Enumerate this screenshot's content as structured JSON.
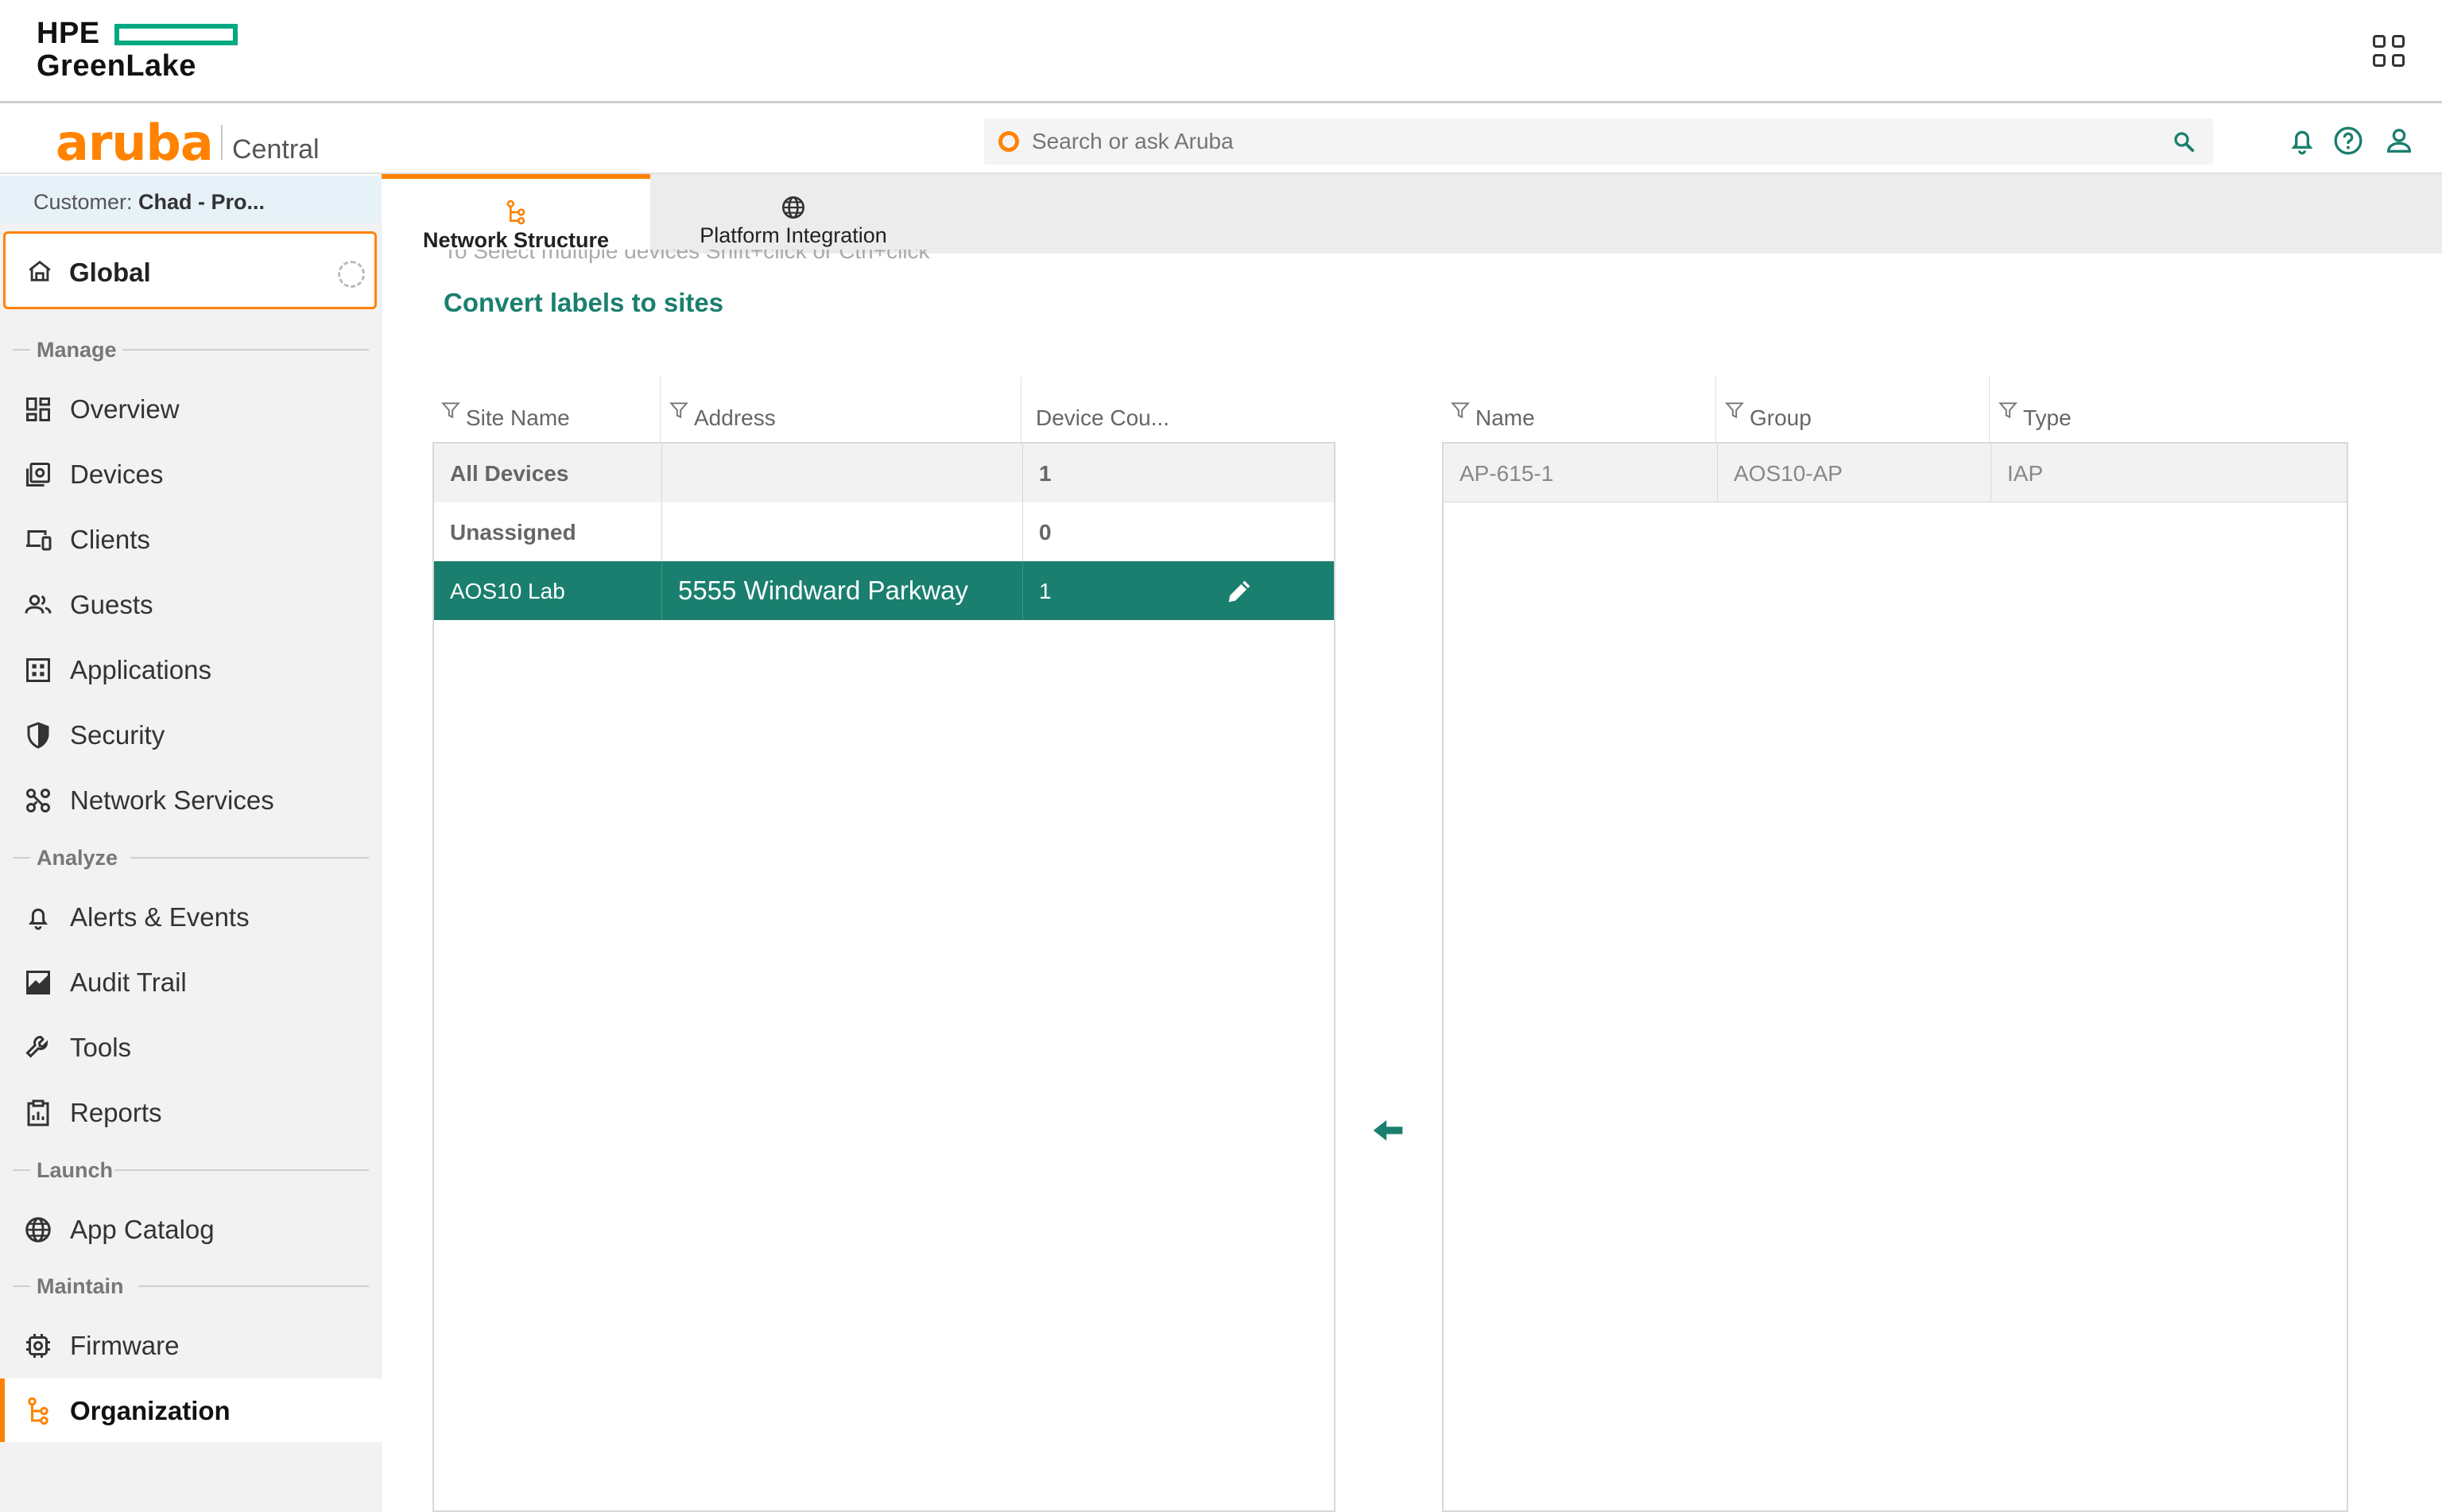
{
  "hpe": {
    "logo_line1": "HPE",
    "logo_line2": "GreenLake",
    "apps_icon": "apps-grid-icon",
    "brand_color": "#01a982"
  },
  "header": {
    "logo": "aruba",
    "product": "Central",
    "search_placeholder": "Search or ask Aruba",
    "accent": "#ff8300",
    "icons": [
      "bell-icon",
      "help-icon",
      "user-icon"
    ]
  },
  "sidebar": {
    "customer_prefix": "Customer: ",
    "customer_name": "Chad - Pro...",
    "scope": "Global",
    "sections": {
      "manage": "Manage",
      "analyze": "Analyze",
      "launch": "Launch",
      "maintain": "Maintain"
    },
    "items": {
      "overview": "Overview",
      "devices": "Devices",
      "clients": "Clients",
      "guests": "Guests",
      "applications": "Applications",
      "security": "Security",
      "network_services": "Network Services",
      "alerts_events": "Alerts & Events",
      "audit_trail": "Audit Trail",
      "tools": "Tools",
      "reports": "Reports",
      "app_catalog": "App Catalog",
      "firmware": "Firmware",
      "organization": "Organization"
    },
    "active_item": "Organization"
  },
  "tabs": {
    "network_structure": "Network Structure",
    "platform_integration": "Platform Integration",
    "active": "Network Structure"
  },
  "main": {
    "hint": "To Select multiple devices Shift+click or Ctrl+click",
    "convert_link": "Convert labels to sites",
    "accent": "#1a7f6e"
  },
  "sites_table": {
    "columns": {
      "site_name": "Site Name",
      "address": "Address",
      "device_count": "Device Cou..."
    },
    "rows": [
      {
        "site_name": "All Devices",
        "address": "",
        "device_count": "1"
      },
      {
        "site_name": "Unassigned",
        "address": "",
        "device_count": "0"
      },
      {
        "site_name": "AOS10 Lab",
        "address": "5555 Windward Parkway",
        "device_count": "1"
      }
    ],
    "selected_row": "AOS10 Lab"
  },
  "devices_table": {
    "columns": {
      "name": "Name",
      "group": "Group",
      "type": "Type"
    },
    "rows": [
      {
        "name": "AP-615-1",
        "group": "AOS10-AP",
        "type": "IAP"
      }
    ]
  }
}
